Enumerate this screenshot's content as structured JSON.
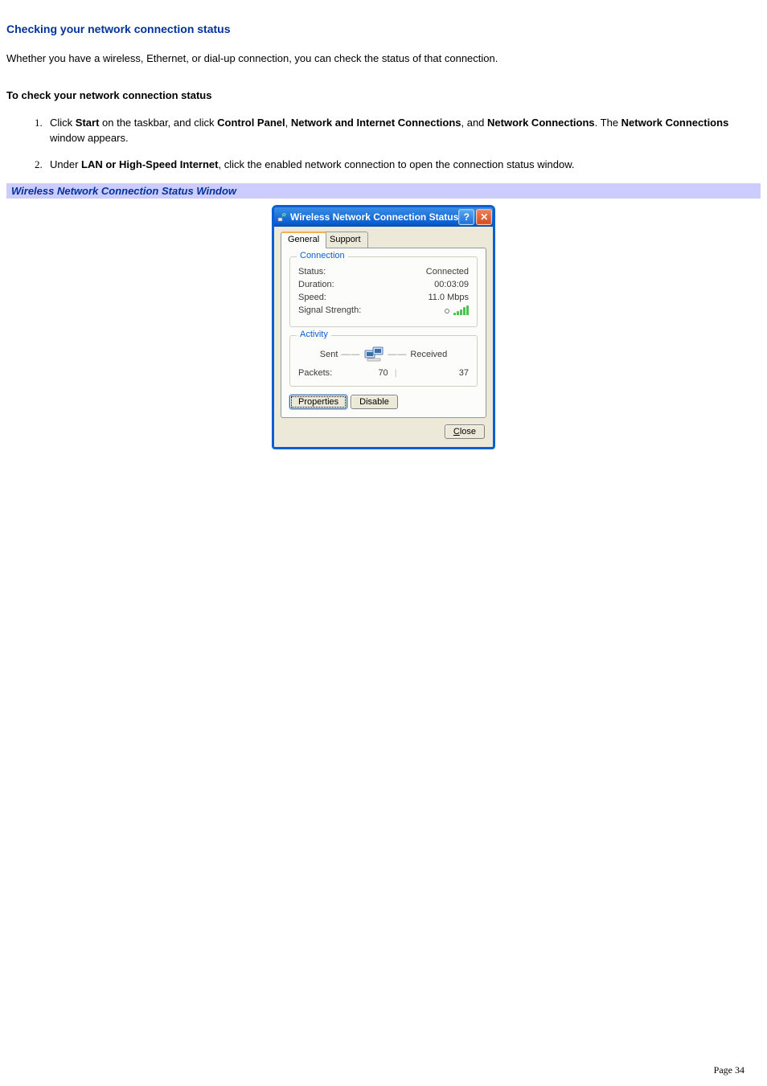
{
  "heading": "Checking your network connection status",
  "intro": "Whether you have a wireless, Ethernet, or dial-up connection, you can check the status of that connection.",
  "procedure_title": "To check your network connection status",
  "steps": {
    "s1": {
      "t1": "Click ",
      "b1": "Start",
      "t2": " on the taskbar, and click ",
      "b2": "Control Panel",
      "t3": ", ",
      "b3": "Network and Internet Connections",
      "t4": ", and ",
      "b4": "Network Connections",
      "t5": ". The ",
      "b5": "Network Connections",
      "t6": " window appears."
    },
    "s2": {
      "t1": "Under ",
      "b1": "LAN or High-Speed Internet",
      "t2": ", click the enabled network connection to open the connection status window."
    }
  },
  "figure_caption": "Wireless Network Connection Status Window",
  "dialog": {
    "title": "Wireless Network Connection Status",
    "help_glyph": "?",
    "close_glyph": "✕",
    "tabs": {
      "general": "General",
      "support": "Support"
    },
    "connection": {
      "legend": "Connection",
      "status_label": "Status:",
      "status_value": "Connected",
      "duration_label": "Duration:",
      "duration_value": "00:03:09",
      "speed_label": "Speed:",
      "speed_value": "11.0 Mbps",
      "signal_label": "Signal Strength:"
    },
    "activity": {
      "legend": "Activity",
      "sent": "Sent",
      "received": "Received",
      "packets_label": "Packets:",
      "packets_sent": "70",
      "packets_received": "37"
    },
    "buttons": {
      "properties": "Properties",
      "disable": "Disable",
      "close": "Close"
    }
  },
  "footer": "Page 34"
}
